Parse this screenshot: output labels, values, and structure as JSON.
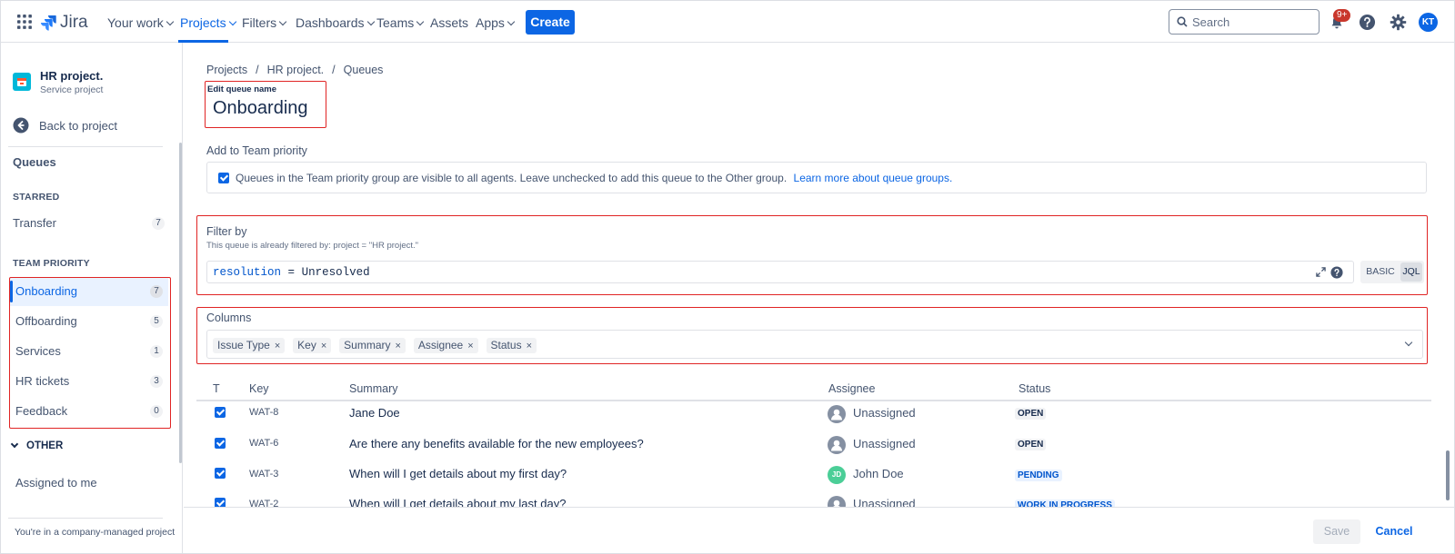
{
  "topnav": {
    "app_name": "Jira",
    "items": [
      {
        "label": "Your work",
        "dropdown": true
      },
      {
        "label": "Projects",
        "dropdown": true
      },
      {
        "label": "Filters",
        "dropdown": true
      },
      {
        "label": "Dashboards",
        "dropdown": true
      },
      {
        "label": "Teams",
        "dropdown": true
      },
      {
        "label": "Assets",
        "dropdown": false
      },
      {
        "label": "Apps",
        "dropdown": true
      }
    ],
    "create_label": "Create",
    "search_placeholder": "Search",
    "notifications_badge": "9+",
    "avatar_initials": "KT",
    "accent": "#0c66e4"
  },
  "sidebar": {
    "project_name": "HR project.",
    "project_type": "Service project",
    "back_label": "Back to project",
    "queues_heading": "Queues",
    "starred_heading": "STARRED",
    "starred_items": [
      {
        "label": "Transfer",
        "count": "7"
      }
    ],
    "team_priority_heading": "TEAM PRIORITY",
    "team_priority_items": [
      {
        "label": "Onboarding",
        "count": "7"
      },
      {
        "label": "Offboarding",
        "count": "5"
      },
      {
        "label": "Services",
        "count": "1"
      },
      {
        "label": "HR tickets",
        "count": "3"
      },
      {
        "label": "Feedback",
        "count": "0"
      }
    ],
    "other_heading": "OTHER",
    "other_items": [
      {
        "label": "Assigned to me"
      }
    ],
    "footer": "You're in a company-managed project"
  },
  "main": {
    "breadcrumbs": [
      "Projects",
      "HR project.",
      "Queues"
    ],
    "edit_queue_label": "Edit queue name",
    "queue_name": "Onboarding",
    "team_priority_label": "Add to Team priority",
    "team_priority_text": "Queues in the Team priority group are visible to all agents. Leave unchecked to add this queue to the Other group.",
    "team_priority_link": "Learn more about queue groups.",
    "filter_label": "Filter by",
    "filter_hint": "This queue is already filtered by:  project = \"HR project.\"",
    "jql_field": "resolution",
    "jql_op": "=",
    "jql_value": "Unresolved",
    "basic_label": "BASIC",
    "jql_label": "JQL",
    "columns_label": "Columns",
    "column_tags": [
      "Issue Type",
      "Key",
      "Summary",
      "Assignee",
      "Status"
    ],
    "table": {
      "headers": [
        "T",
        "Key",
        "Summary",
        "Assignee",
        "Status"
      ],
      "rows": [
        {
          "key": "WAT-8",
          "summary": "Jane Doe",
          "assignee": "Unassigned",
          "status": "OPEN"
        },
        {
          "key": "WAT-6",
          "summary": "Are there any benefits available for the new employees?",
          "assignee": "Unassigned",
          "status": "OPEN"
        },
        {
          "key": "WAT-3",
          "summary": "When will I get details about my first day?",
          "assignee": "John Doe",
          "assignee_initials": "JD",
          "status": "PENDING"
        },
        {
          "key": "WAT-2",
          "summary": "When will I get details about my last day?",
          "assignee": "Unassigned",
          "status": "WORK IN PROGRESS"
        }
      ]
    },
    "save_label": "Save",
    "cancel_label": "Cancel"
  }
}
